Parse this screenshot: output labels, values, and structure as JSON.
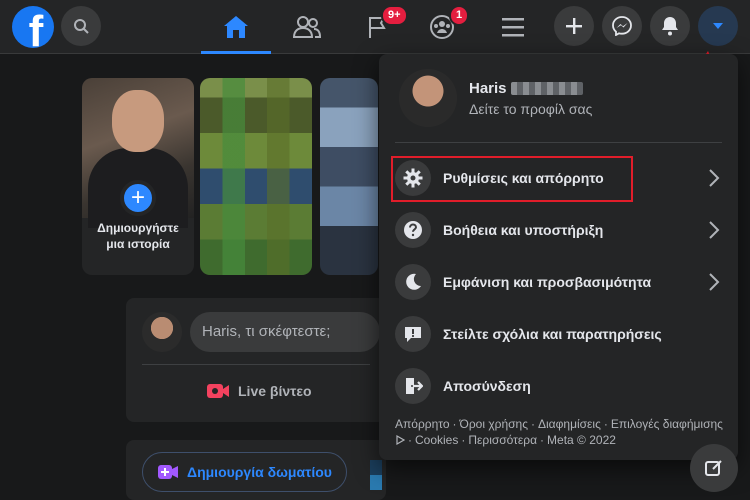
{
  "header": {
    "logo_letter": "f",
    "nav": [
      {
        "name": "home",
        "active": true
      },
      {
        "name": "friends",
        "active": false
      },
      {
        "name": "pages",
        "badge": "9+"
      },
      {
        "name": "groups",
        "badge": "1"
      },
      {
        "name": "menu",
        "active": false
      }
    ],
    "right_icons": [
      "plus-icon",
      "messenger-icon",
      "bell-icon",
      "account-caret-icon"
    ]
  },
  "stories": {
    "create_label": "Δημιουργήστε μια ιστορία"
  },
  "composer": {
    "placeholder": "Haris, τι σκέφτεστε;",
    "live_label": "Live βίντεο"
  },
  "rooms": {
    "create_room_label": "Δημιουργία δωματίου"
  },
  "account_menu": {
    "profile_name": "Haris",
    "profile_sub": "Δείτε το προφίλ σας",
    "items": [
      {
        "label": "Ρυθμίσεις και απόρρητο",
        "icon": "gear-icon",
        "chevron": true
      },
      {
        "label": "Βοήθεια και υποστήριξη",
        "icon": "help-icon",
        "chevron": true
      },
      {
        "label": "Εμφάνιση και προσβασιμότητα",
        "icon": "moon-icon",
        "chevron": true
      },
      {
        "label": "Στείλτε σχόλια και παρατηρήσεις",
        "icon": "feedback-icon",
        "chevron": false
      },
      {
        "label": "Αποσύνδεση",
        "icon": "logout-icon",
        "chevron": false
      }
    ],
    "footer": {
      "privacy": "Απόρρητο",
      "terms": "Όροι χρήσης",
      "ads": "Διαφημίσεις",
      "ad_choices": "Επιλογές διαφήμισης",
      "cookies": "Cookies",
      "more": "Περισσότερα",
      "copyright": "Meta © 2022"
    }
  },
  "colors": {
    "accent": "#2d88ff",
    "highlight": "#e11d2a",
    "badge": "#e41e3f"
  }
}
